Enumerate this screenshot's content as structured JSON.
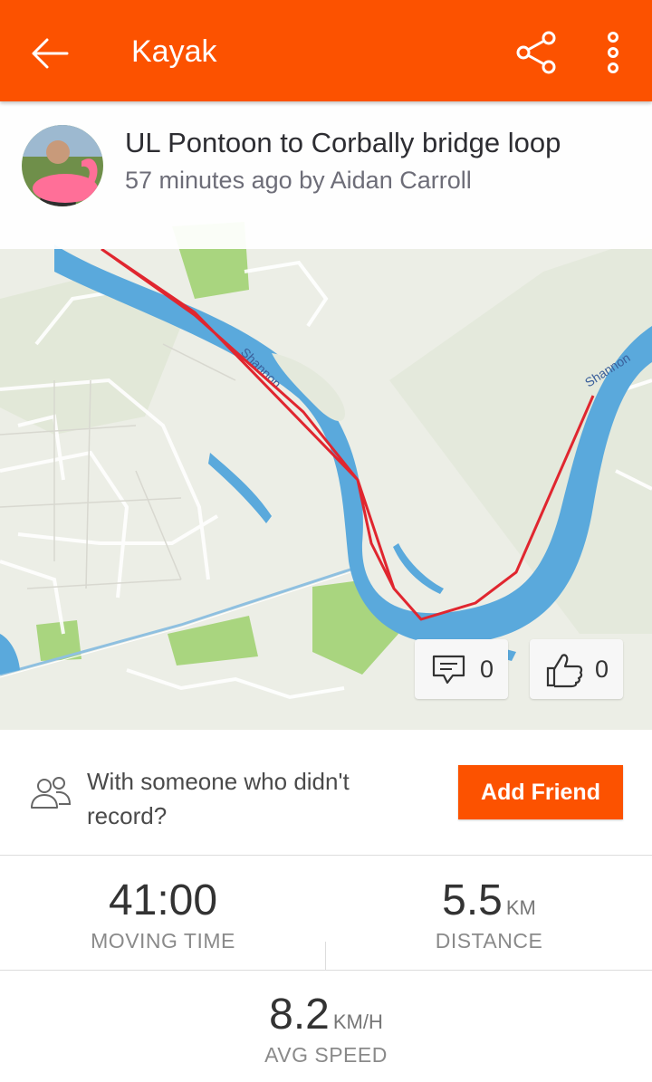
{
  "app_bar": {
    "back_icon": "arrow-left-icon",
    "title": "Kayak",
    "share_icon": "share-icon",
    "more_icon": "more-vertical-icon"
  },
  "activity": {
    "name": "UL Pontoon to Corbally bridge loop",
    "time_ago": "57 minutes ago by",
    "author": "Aidan Carroll"
  },
  "map": {
    "river_labels": [
      "Shannon",
      "Shannon"
    ],
    "route_color": "#e0262f",
    "water_color": "#5aa9dc",
    "park_color": "#a9d57f"
  },
  "counters": {
    "comment_icon": "comment-icon",
    "comments": "0",
    "kudos_icon": "thumbs-up-icon",
    "kudos": "0"
  },
  "friend_prompt": {
    "icon": "people-icon",
    "text": "With someone who didn't record?",
    "button": "Add Friend"
  },
  "stats": {
    "moving_time": {
      "value": "41:00",
      "label": "MOVING TIME"
    },
    "distance": {
      "value": "5.5",
      "unit": "KM",
      "label": "DISTANCE"
    },
    "avg_speed": {
      "value": "8.2",
      "unit": "KM/H",
      "label": "AVG SPEED"
    }
  },
  "colors": {
    "accent": "#fc5200"
  }
}
